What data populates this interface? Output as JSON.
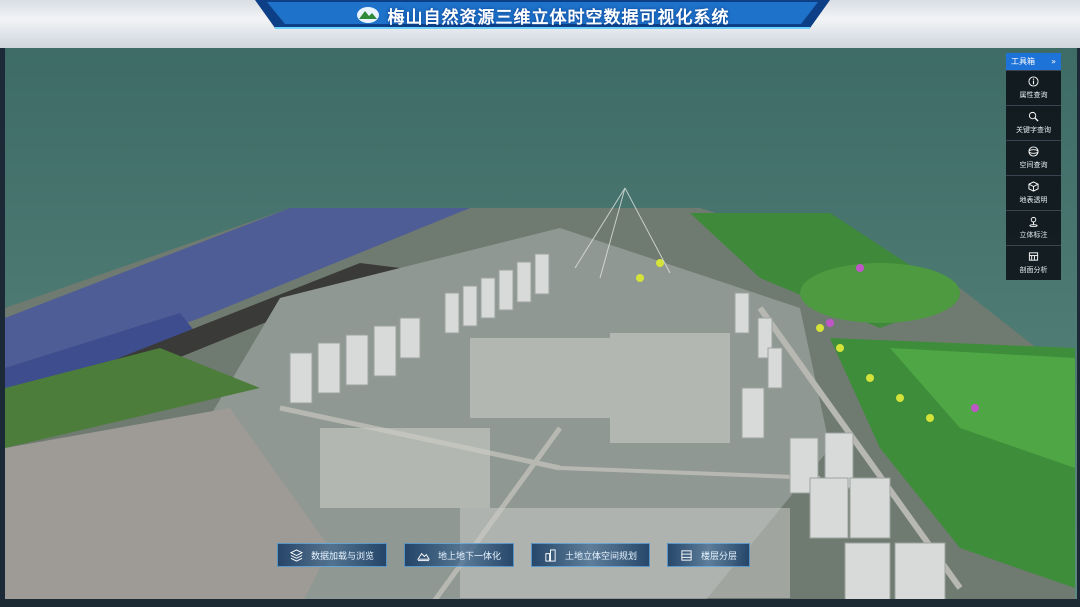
{
  "header": {
    "title": "梅山自然资源三维立体时空数据可视化系统"
  },
  "toolbox": {
    "title": "工具箱",
    "collapse_icon": "double-chevron-right-icon",
    "items": [
      {
        "label": "属性查询",
        "icon": "info-icon"
      },
      {
        "label": "关键字查询",
        "icon": "search-icon"
      },
      {
        "label": "空间查询",
        "icon": "spatial-query-icon"
      },
      {
        "label": "地表透明",
        "icon": "cube-icon"
      },
      {
        "label": "立体标注",
        "icon": "pin-icon"
      },
      {
        "label": "剖面分析",
        "icon": "section-icon"
      }
    ]
  },
  "bottom_nav": [
    {
      "label": "数据加载与浏览",
      "icon": "layers-icon"
    },
    {
      "label": "地上地下一体化",
      "icon": "terrain-icon"
    },
    {
      "label": "土地立体空间规划",
      "icon": "buildings-icon"
    },
    {
      "label": "楼层分层",
      "icon": "floor-icon"
    }
  ],
  "colors": {
    "accent": "#1e73d8",
    "water": "#4b7a74",
    "panel": "#0a0e14"
  }
}
